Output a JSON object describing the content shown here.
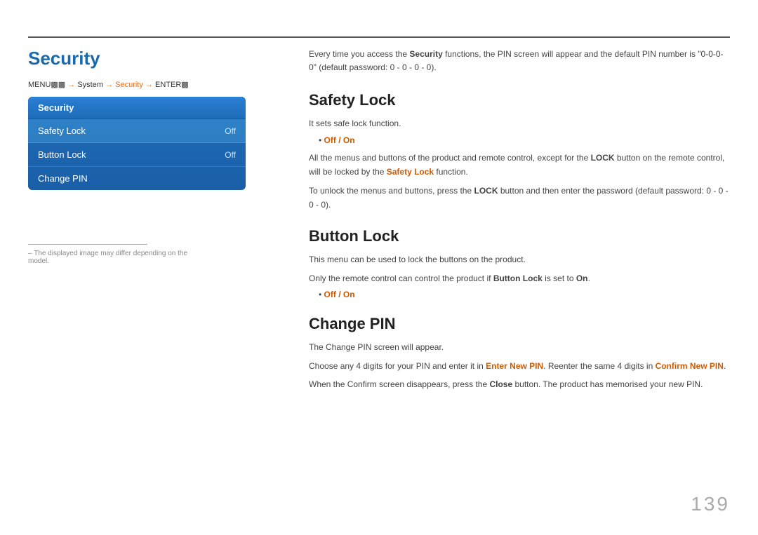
{
  "top_border": true,
  "page_title": "Security",
  "menu_path": {
    "full": "MENU  →  System  →  Security  →  ENTER ",
    "menu_label": "MENU",
    "arrow1": "→",
    "system": "System",
    "arrow2": "→",
    "security": "Security",
    "arrow3": "→",
    "enter": "ENTER"
  },
  "security_panel": {
    "header": "Security",
    "items": [
      {
        "label": "Safety Lock",
        "value": "Off",
        "active": true
      },
      {
        "label": "Button Lock",
        "value": "Off",
        "active": false
      },
      {
        "label": "Change PIN",
        "value": "",
        "active": false
      }
    ]
  },
  "footnote": "─  The displayed image may differ depending on the model.",
  "intro": "Every time you access the Security functions, the PIN screen will appear and the default PIN number is \"0-0-0-0\" (default password: 0 - 0 - 0 - 0).",
  "sections": [
    {
      "id": "safety-lock",
      "title": "Safety Lock",
      "paragraphs": [
        "It sets safe lock function.",
        "All the menus and buttons of the product and remote control, except for the LOCK button on the remote control, will be locked by the Safety Lock function.",
        "To unlock the menus and buttons, press the LOCK button and then enter the password (default password: 0 - 0 - 0 - 0)."
      ],
      "bullet": "Off / On",
      "bold_in_p2": [
        "LOCK",
        "Safety Lock"
      ],
      "bold_in_p3": [
        "LOCK"
      ]
    },
    {
      "id": "button-lock",
      "title": "Button Lock",
      "paragraphs": [
        "This menu can be used to lock the buttons on the product.",
        "Only the remote control can control the product if Button Lock is set to On."
      ],
      "bullet": "Off / On",
      "bold_in_p2": [
        "Button Lock",
        "On"
      ]
    },
    {
      "id": "change-pin",
      "title": "Change PIN",
      "paragraphs": [
        "The Change PIN screen will appear.",
        "Choose any 4 digits for your PIN and enter it in Enter New PIN. Reenter the same 4 digits in Confirm New PIN.",
        "When the Confirm screen disappears, press the Close button. The product has memorised your new PIN."
      ],
      "bold_in_p2_orange": [
        "Enter New PIN",
        "Confirm New PIN"
      ],
      "bold_in_p3": [
        "Close"
      ]
    }
  ],
  "page_number": "139"
}
